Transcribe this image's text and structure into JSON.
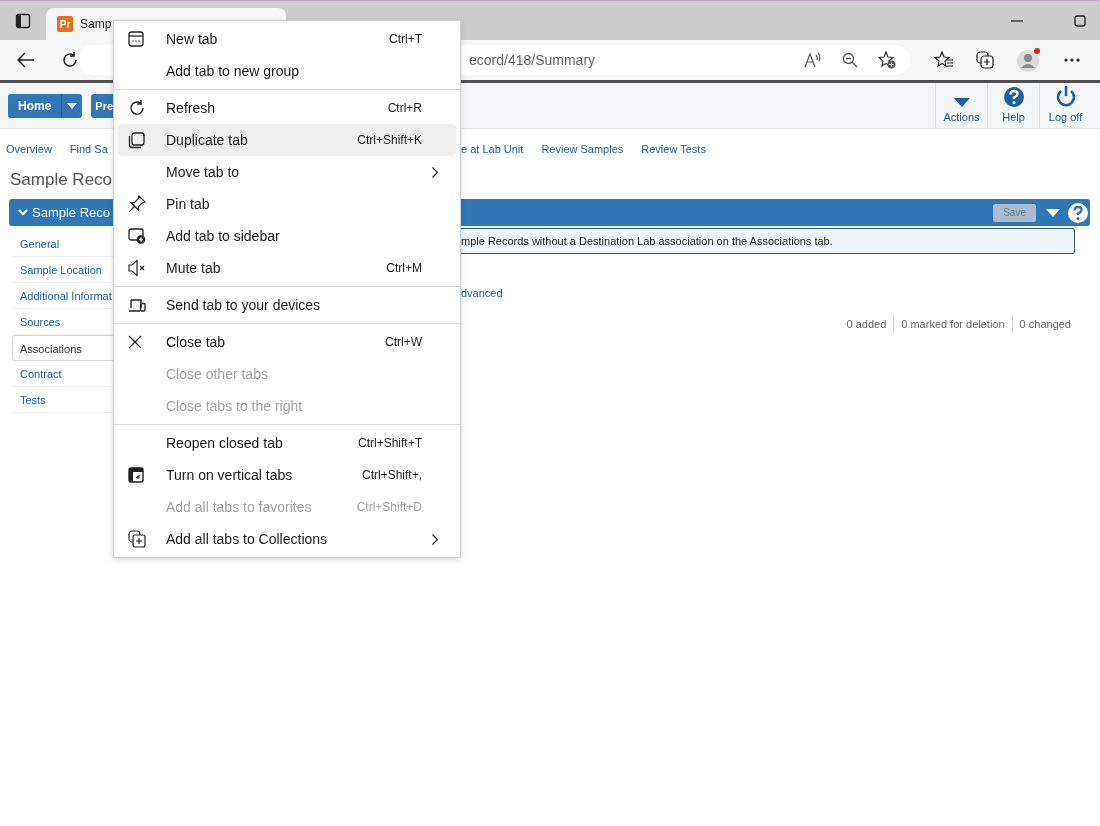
{
  "browser": {
    "favicon": "Pr",
    "tab_title": "Samp",
    "url": "ecord/418/Summary"
  },
  "app_bar": {
    "home_button": "Home",
    "other_button": "Pre",
    "actions": [
      {
        "kind": "caret",
        "label": "Actions"
      },
      {
        "kind": "help",
        "label": "Help"
      },
      {
        "kind": "power",
        "label": "Log off"
      }
    ]
  },
  "nav_links_left": [
    "Overview",
    "Find Sa"
  ],
  "nav_links_right": [
    "e at Lab Unit",
    "Review Samples",
    "Review Tests"
  ],
  "page_title": "Sample Reco",
  "panel": {
    "title": "Sample Reco",
    "save_button": {
      "label": "Save",
      "disabled": true
    }
  },
  "sections": [
    {
      "label": "General",
      "selected": false
    },
    {
      "label": "Sample Location",
      "selected": false
    },
    {
      "label": "Additional Informat",
      "selected": false
    },
    {
      "label": "Sources",
      "selected": false
    },
    {
      "label": "Associations",
      "selected": true
    },
    {
      "label": "Contract",
      "selected": false
    },
    {
      "label": "Tests",
      "selected": false
    }
  ],
  "info_message": "mple Records without a Destination Lab association on the Associations tab.",
  "advanced_link": "dvanced",
  "counts": [
    "0 added",
    "0 marked for deletion",
    "0 changed"
  ],
  "context_menu": [
    [
      {
        "kind": "new-tab",
        "label": "New tab",
        "shortcut": "Ctrl+T",
        "disabled": false,
        "highlighted": false,
        "submenu": false
      },
      {
        "kind": "plain",
        "label": "Add tab to new group",
        "disabled": false,
        "highlighted": false,
        "submenu": false
      }
    ],
    [
      {
        "kind": "refresh",
        "label": "Refresh",
        "shortcut": "Ctrl+R",
        "disabled": false,
        "highlighted": false,
        "submenu": false
      },
      {
        "kind": "duplicate",
        "label": "Duplicate tab",
        "shortcut": "Ctrl+Shift+K",
        "disabled": false,
        "highlighted": true,
        "submenu": false
      },
      {
        "kind": "plain",
        "label": "Move tab to",
        "disabled": false,
        "highlighted": false,
        "submenu": true
      },
      {
        "kind": "pin",
        "label": "Pin tab",
        "disabled": false,
        "highlighted": false,
        "submenu": false
      },
      {
        "kind": "sidebar",
        "label": "Add tab to sidebar",
        "disabled": false,
        "highlighted": false,
        "submenu": false
      },
      {
        "kind": "mute",
        "label": "Mute tab",
        "shortcut": "Ctrl+M",
        "disabled": false,
        "highlighted": false,
        "submenu": false
      }
    ],
    [
      {
        "kind": "devices",
        "label": "Send tab to your devices",
        "disabled": false,
        "highlighted": false,
        "submenu": false
      }
    ],
    [
      {
        "kind": "close",
        "label": "Close tab",
        "shortcut": "Ctrl+W",
        "disabled": false,
        "highlighted": false,
        "submenu": false
      },
      {
        "kind": "plain",
        "label": "Close other tabs",
        "disabled": true,
        "highlighted": false,
        "submenu": false
      },
      {
        "kind": "plain",
        "label": "Close tabs to the right",
        "disabled": true,
        "highlighted": false,
        "submenu": false
      }
    ],
    [
      {
        "kind": "plain",
        "label": "Reopen closed tab",
        "shortcut": "Ctrl+Shift+T",
        "disabled": false,
        "highlighted": false,
        "submenu": false
      },
      {
        "kind": "vertical-tabs",
        "label": "Turn on vertical tabs",
        "shortcut": "Ctrl+Shift+,",
        "disabled": false,
        "highlighted": false,
        "submenu": false
      },
      {
        "kind": "plain",
        "label": "Add all tabs to favorites",
        "shortcut": "Ctrl+Shift+D",
        "disabled": true,
        "highlighted": false,
        "submenu": false
      },
      {
        "kind": "collections",
        "label": "Add all tabs to Collections",
        "disabled": false,
        "highlighted": false,
        "submenu": true
      }
    ]
  ]
}
